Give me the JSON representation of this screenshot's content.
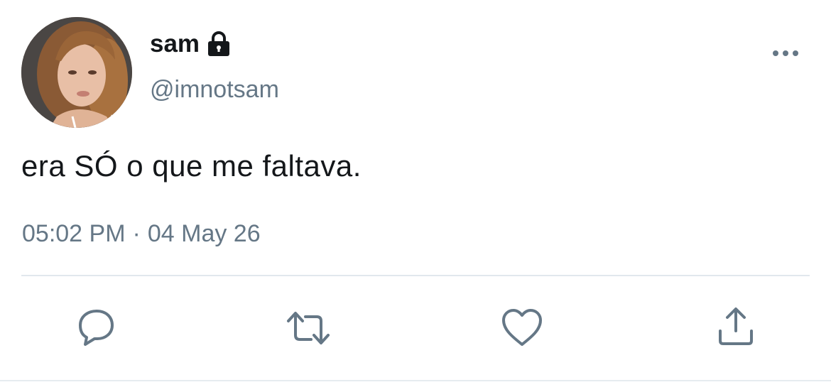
{
  "user": {
    "display_name": "sam",
    "handle": "@imnotsam",
    "protected": true
  },
  "tweet": {
    "text": "era SÓ o que me faltava.",
    "time": "05:02 PM",
    "separator": "·",
    "date": "04 May 26"
  },
  "actions": {
    "reply_icon": "reply-icon",
    "retweet_icon": "retweet-icon",
    "like_icon": "heart-icon",
    "share_icon": "share-icon"
  },
  "colors": {
    "text_primary": "#14171a",
    "text_secondary": "#657786",
    "divider": "#e1e8ed"
  }
}
